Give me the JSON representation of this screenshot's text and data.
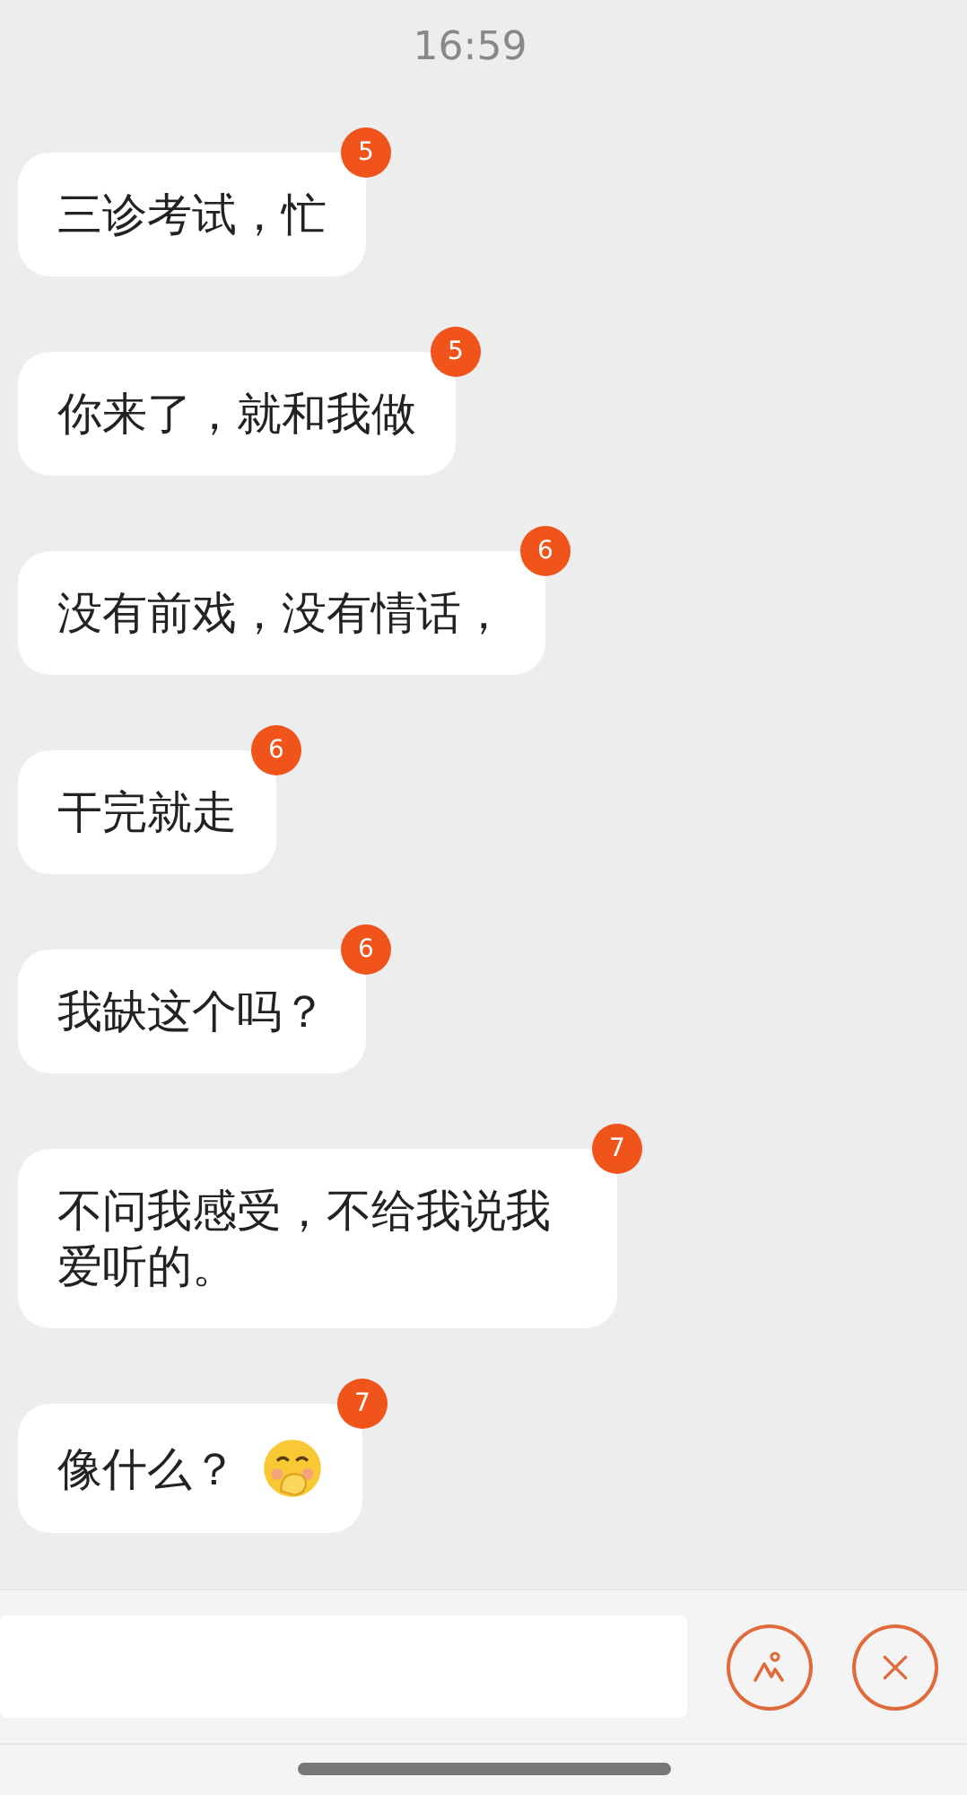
{
  "status_bar": {
    "time": "16:59"
  },
  "messages": [
    {
      "text": "三诊考试，忙",
      "badge": "5",
      "emoji": false
    },
    {
      "text": "你来了，就和我做",
      "badge": "5",
      "emoji": false
    },
    {
      "text": "没有前戏，没有情话，",
      "badge": "6",
      "emoji": false
    },
    {
      "text": "干完就走",
      "badge": "6",
      "emoji": false
    },
    {
      "text": "我缺这个吗？",
      "badge": "6",
      "emoji": false
    },
    {
      "text": "不问我感受，不给我说我爱听的。",
      "badge": "7",
      "emoji": false
    },
    {
      "text": "像什么？",
      "badge": "7",
      "emoji": true
    }
  ],
  "input_bar": {
    "kind": "text"
  }
}
